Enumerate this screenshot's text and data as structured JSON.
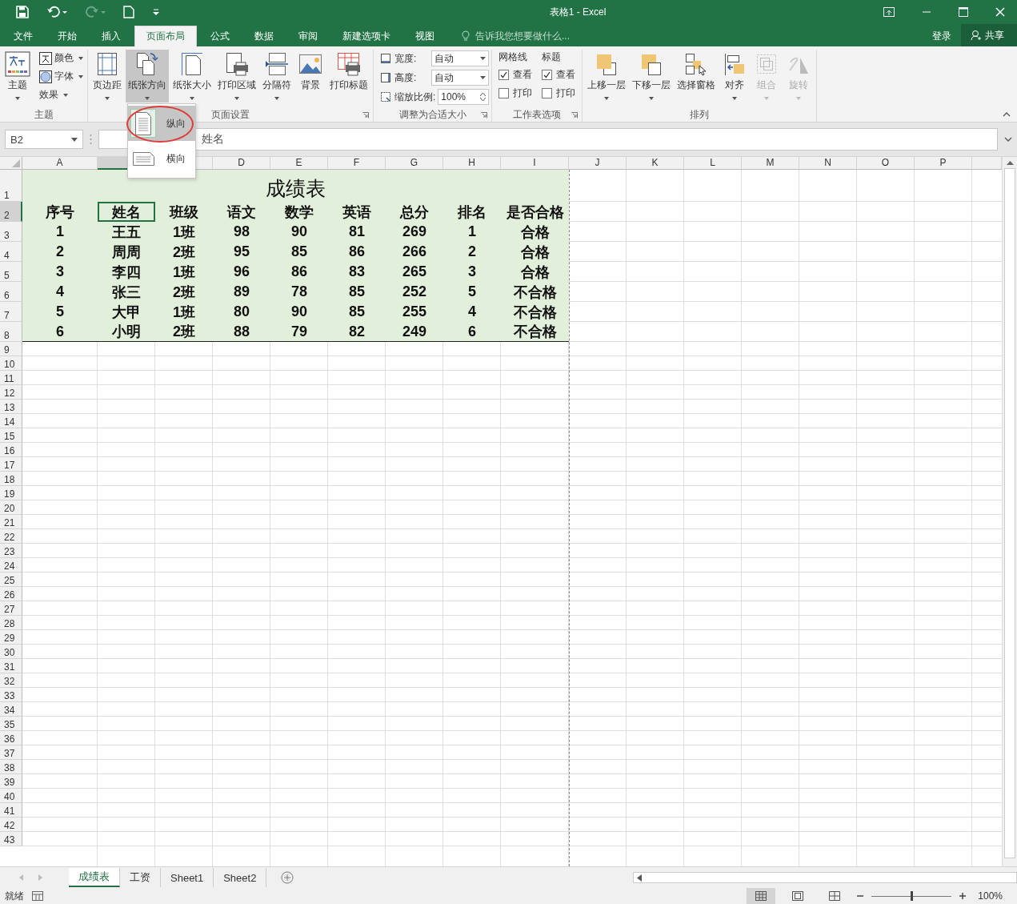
{
  "window": {
    "title": "表格1 - Excel"
  },
  "tabs": [
    {
      "label": "文件",
      "selected": false
    },
    {
      "label": "开始",
      "selected": false
    },
    {
      "label": "插入",
      "selected": false
    },
    {
      "label": "页面布局",
      "selected": true
    },
    {
      "label": "公式",
      "selected": false
    },
    {
      "label": "数据",
      "selected": false
    },
    {
      "label": "审阅",
      "selected": false
    },
    {
      "label": "新建选项卡",
      "selected": false
    },
    {
      "label": "视图",
      "selected": false
    }
  ],
  "tell_me": {
    "placeholder": "告诉我您想要做什么..."
  },
  "account": {
    "sign_in": "登录",
    "share": "共享"
  },
  "ribbon": {
    "groups": [
      {
        "name": "主题",
        "launcher": false,
        "items": [
          {
            "kind": "large",
            "label": "主题",
            "caret": true,
            "pressed": false,
            "disabled": false
          },
          {
            "kind": "small",
            "label": "颜色",
            "caret": true
          },
          {
            "kind": "small",
            "label": "字体",
            "caret": true
          },
          {
            "kind": "small",
            "label": "效果",
            "caret": true
          }
        ]
      },
      {
        "name": "页面设置",
        "launcher": true,
        "items": [
          {
            "kind": "large",
            "label": "页边距",
            "caret": true,
            "pressed": false,
            "disabled": false
          },
          {
            "kind": "large",
            "label": "纸张方向",
            "caret": true,
            "pressed": true,
            "disabled": false
          },
          {
            "kind": "large",
            "label": "纸张大小",
            "caret": true,
            "pressed": false,
            "disabled": false
          },
          {
            "kind": "large",
            "label": "打印区域",
            "caret": true,
            "pressed": false,
            "disabled": false
          },
          {
            "kind": "large",
            "label": "分隔符",
            "caret": true,
            "pressed": false,
            "disabled": false
          },
          {
            "kind": "large",
            "label": "背景",
            "caret": false,
            "pressed": false,
            "disabled": false
          },
          {
            "kind": "large",
            "label": "打印标题",
            "caret": false,
            "pressed": false,
            "disabled": false
          }
        ]
      },
      {
        "name": "调整为合适大小",
        "launcher": true,
        "items": [
          {
            "kind": "dropdown",
            "label": "宽度:",
            "value": "自动"
          },
          {
            "kind": "dropdown",
            "label": "高度:",
            "value": "自动"
          },
          {
            "kind": "spinner",
            "label": "缩放比例:",
            "value": "100%"
          }
        ]
      },
      {
        "name": "工作表选项",
        "launcher": true,
        "items": [
          {
            "kind": "options",
            "title": "网格线",
            "options": [
              {
                "label": "查看",
                "checked": true
              },
              {
                "label": "打印",
                "checked": false
              }
            ]
          },
          {
            "kind": "options",
            "title": "标题",
            "options": [
              {
                "label": "查看",
                "checked": true
              },
              {
                "label": "打印",
                "checked": false
              }
            ]
          }
        ]
      },
      {
        "name": "排列",
        "launcher": false,
        "items": [
          {
            "kind": "large",
            "label": "上移一层",
            "caret": true,
            "pressed": false,
            "disabled": false
          },
          {
            "kind": "large",
            "label": "下移一层",
            "caret": true,
            "pressed": false,
            "disabled": false
          },
          {
            "kind": "large",
            "label": "选择窗格",
            "caret": false,
            "pressed": false,
            "disabled": false
          },
          {
            "kind": "large",
            "label": "对齐",
            "caret": true,
            "pressed": false,
            "disabled": false
          },
          {
            "kind": "large",
            "label": "组合",
            "caret": true,
            "pressed": false,
            "disabled": true
          },
          {
            "kind": "large",
            "label": "旋转",
            "caret": true,
            "pressed": false,
            "disabled": true
          }
        ]
      }
    ]
  },
  "orientation_menu": {
    "items": [
      {
        "label": "纵向",
        "selected": true,
        "circled": true
      },
      {
        "label": "横向",
        "selected": false,
        "circled": false
      }
    ]
  },
  "formula_bar": {
    "name_box": "B2",
    "formula": "姓名"
  },
  "columns": [
    {
      "label": "A",
      "selected": false
    },
    {
      "selected": true
    },
    {
      "selected": false
    },
    {
      "label": "D",
      "selected": false
    },
    {
      "label": "E",
      "selected": false
    },
    {
      "label": "F",
      "selected": false
    },
    {
      "label": "G",
      "selected": false
    },
    {
      "label": "H",
      "selected": false
    },
    {
      "label": "I",
      "selected": false
    },
    {
      "label": "J",
      "selected": false
    },
    {
      "label": "K",
      "selected": false
    },
    {
      "label": "L",
      "selected": false
    },
    {
      "label": "M",
      "selected": false
    },
    {
      "label": "N",
      "selected": false
    },
    {
      "label": "O",
      "selected": false
    },
    {
      "label": "P",
      "selected": false
    }
  ],
  "rows": [
    {
      "label": "1",
      "selected": false
    },
    {
      "label": "2",
      "selected": true
    },
    {
      "label": "3",
      "selected": false
    },
    {
      "label": "4",
      "selected": false
    },
    {
      "label": "5",
      "selected": false
    },
    {
      "label": "6",
      "selected": false
    },
    {
      "label": "7",
      "selected": false
    },
    {
      "label": "8",
      "selected": false
    },
    {
      "label": "9",
      "selected": false
    },
    {
      "label": "10",
      "selected": false
    },
    {
      "label": "11",
      "selected": false
    },
    {
      "label": "12",
      "selected": false
    },
    {
      "label": "13",
      "selected": false
    },
    {
      "label": "14",
      "selected": false
    },
    {
      "label": "15",
      "selected": false
    },
    {
      "label": "16",
      "selected": false
    },
    {
      "label": "17",
      "selected": false
    },
    {
      "label": "18",
      "selected": false
    },
    {
      "label": "19",
      "selected": false
    },
    {
      "label": "20",
      "selected": false
    },
    {
      "label": "21",
      "selected": false
    },
    {
      "label": "22",
      "selected": false
    },
    {
      "label": "23",
      "selected": false
    },
    {
      "label": "24",
      "selected": false
    },
    {
      "label": "25",
      "selected": false
    },
    {
      "label": "26",
      "selected": false
    },
    {
      "label": "27",
      "selected": false
    },
    {
      "label": "28",
      "selected": false
    },
    {
      "label": "29",
      "selected": false
    },
    {
      "label": "30",
      "selected": false
    },
    {
      "label": "31",
      "selected": false
    },
    {
      "label": "32",
      "selected": false
    },
    {
      "label": "33",
      "selected": false
    },
    {
      "label": "34",
      "selected": false
    },
    {
      "label": "35",
      "selected": false
    },
    {
      "label": "36",
      "selected": false
    },
    {
      "label": "37",
      "selected": false
    },
    {
      "label": "38",
      "selected": false
    },
    {
      "label": "39",
      "selected": false
    },
    {
      "label": "40",
      "selected": false
    },
    {
      "label": "41",
      "selected": false
    },
    {
      "label": "42",
      "selected": false
    },
    {
      "label": "43",
      "selected": false
    }
  ],
  "table": {
    "title": "成绩表",
    "header": [
      {
        "text": "序号",
        "selected": false
      },
      {
        "text": "姓名",
        "selected": true
      },
      {
        "text": "班级",
        "selected": false
      },
      {
        "text": "语文",
        "selected": false
      },
      {
        "text": "数学",
        "selected": false
      },
      {
        "text": "英语",
        "selected": false
      },
      {
        "text": "总分",
        "selected": false
      },
      {
        "text": "排名",
        "selected": false
      },
      {
        "text": "是否合格",
        "selected": false
      }
    ],
    "rows": [
      [
        "1",
        "王五",
        "1班",
        "98",
        "90",
        "81",
        "269",
        "1",
        "合格"
      ],
      [
        "2",
        "周周",
        "2班",
        "95",
        "85",
        "86",
        "266",
        "2",
        "合格"
      ],
      [
        "3",
        "李四",
        "1班",
        "96",
        "86",
        "83",
        "265",
        "3",
        "合格"
      ],
      [
        "4",
        "张三",
        "2班",
        "89",
        "78",
        "85",
        "252",
        "5",
        "不合格"
      ],
      [
        "5",
        "大甲",
        "1班",
        "80",
        "90",
        "85",
        "255",
        "4",
        "不合格"
      ],
      [
        "6",
        "小明",
        "2班",
        "88",
        "79",
        "82",
        "249",
        "6",
        "不合格"
      ]
    ]
  },
  "sheet_tabs": [
    {
      "label": "成绩表",
      "selected": true
    },
    {
      "label": "工资",
      "selected": false
    },
    {
      "label": "Sheet1",
      "selected": false
    },
    {
      "label": "Sheet2",
      "selected": false
    }
  ],
  "status_bar": {
    "status": "就绪",
    "zoom": "100%",
    "zoom_level": {
      "level": 0.5
    }
  }
}
